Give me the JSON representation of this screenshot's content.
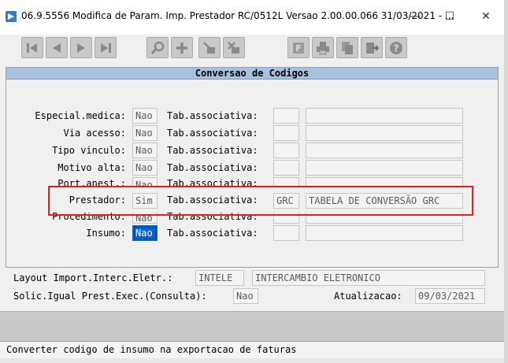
{
  "window": {
    "title": "06.9.5556  Modifica de Param. Imp. Prestador RC/0512L Versao 2.00.00.066 31/03/2021 - ...",
    "minimize_glyph": "—",
    "maximize_glyph": "☐",
    "close_glyph": "✕",
    "app_icon": "progress-app-icon"
  },
  "toolbar": {
    "buttons": [
      {
        "icon": "first-record-icon"
      },
      {
        "icon": "prev-record-icon"
      },
      {
        "icon": "next-record-icon"
      },
      {
        "icon": "last-record-icon"
      },
      {
        "icon": "search-icon"
      },
      {
        "icon": "add-icon"
      },
      {
        "icon": "edit-icon"
      },
      {
        "icon": "delete-icon"
      },
      {
        "icon": "filter-icon"
      },
      {
        "icon": "print-icon"
      },
      {
        "icon": "copy-icon"
      },
      {
        "icon": "exit-icon"
      },
      {
        "icon": "help-icon"
      }
    ],
    "filter_letter": "F",
    "help_glyph": "?"
  },
  "panel": {
    "title": "Conversao de Codigos",
    "assoc_label": "Tab.associativa:",
    "rows": [
      {
        "label": "Especial.medica:",
        "value": "Nao",
        "code": "",
        "desc": ""
      },
      {
        "label": "Via acesso:",
        "value": "Nao",
        "code": "",
        "desc": ""
      },
      {
        "label": "Tipo vinculo:",
        "value": "Nao",
        "code": "",
        "desc": ""
      },
      {
        "label": "Motivo alta:",
        "value": "Nao",
        "code": "",
        "desc": ""
      },
      {
        "label": "Port.anest.:",
        "value": "Nao",
        "code": "",
        "desc": ""
      },
      {
        "label": "Prestador:",
        "value": "Sim",
        "code": "GRC",
        "desc": "TABELA DE CONVERSÃO GRC"
      },
      {
        "label": "Procedimento:",
        "value": "Nao",
        "code": "",
        "desc": ""
      },
      {
        "label": "Insumo:",
        "value": "Nao",
        "code": "",
        "desc": ""
      }
    ]
  },
  "footer": {
    "layout_label": "Layout Import.Interc.Eletr.:",
    "layout_code": "INTELE",
    "layout_desc": "INTERCAMBIO ELETRONICO",
    "solic_label": "Solic.Igual Prest.Exec.(Consulta):",
    "solic_value": "Nao",
    "atualizacao_label": "Atualizacao:",
    "atualizacao_value": "09/03/2021"
  },
  "status": {
    "message": "Converter codigo de insumo na exportacao de faturas"
  },
  "colors": {
    "header_blue": "#a8c1dd",
    "focus_blue": "#0a64c8",
    "highlight_red": "#e02020"
  }
}
